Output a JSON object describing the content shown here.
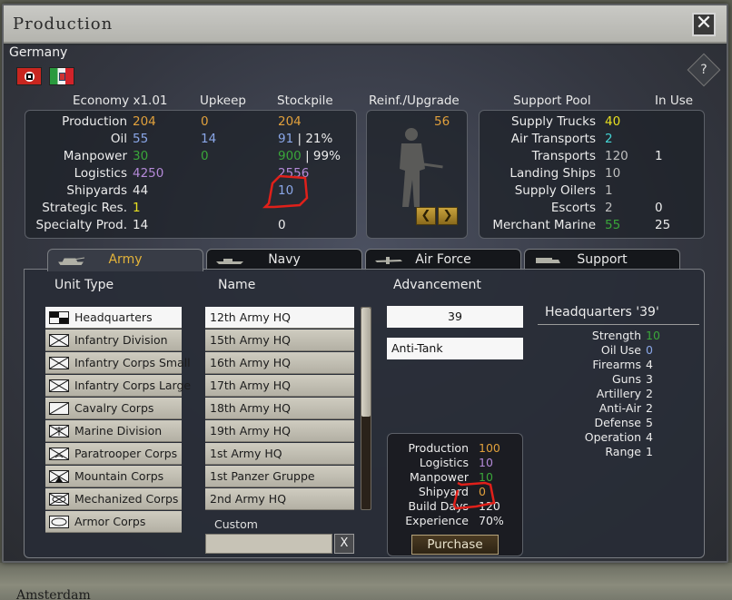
{
  "window": {
    "title": "Production",
    "close_symbol": "✕"
  },
  "map": {
    "city_label": "Amsterdam"
  },
  "country": {
    "name": "Germany",
    "help_symbol": "?"
  },
  "economy": {
    "headers": {
      "economy": "Economy x1.01",
      "upkeep": "Upkeep",
      "stockpile": "Stockpile"
    },
    "rows": [
      {
        "label": "Production",
        "value": "204",
        "value_color": "orange",
        "upkeep": "0",
        "upkeep_color": "orange",
        "stockpile": "204",
        "stockpile_color": "orange"
      },
      {
        "label": "Oil",
        "value": "55",
        "value_color": "blue",
        "upkeep": "14",
        "upkeep_color": "blue",
        "stockpile": "91",
        "stockpile_color": "blue",
        "extra": "| 21%"
      },
      {
        "label": "Manpower",
        "value": "30",
        "value_color": "green",
        "upkeep": "0",
        "upkeep_color": "green",
        "stockpile": "900",
        "stockpile_color": "green",
        "extra": "| 99%"
      },
      {
        "label": "Logistics",
        "value": "4250",
        "value_color": "purple",
        "upkeep": "",
        "stockpile": "2556",
        "stockpile_color": "purple"
      },
      {
        "label": "Shipyards",
        "value": "44",
        "value_color": "white",
        "upkeep": "",
        "stockpile": "10",
        "stockpile_color": "blue"
      },
      {
        "label": "Strategic Res.",
        "value": "1",
        "value_color": "yellow",
        "upkeep": "",
        "stockpile": ""
      },
      {
        "label": "Specialty Prod.",
        "value": "14",
        "value_color": "white",
        "upkeep": "",
        "stockpile": "0",
        "stockpile_color": "white"
      }
    ]
  },
  "reinforce": {
    "header": "Reinf./Upgrade",
    "value": "56",
    "prev_symbol": "❮",
    "next_symbol": "❯"
  },
  "support_pool": {
    "headers": {
      "pool": "Support Pool",
      "in_use": "In Use"
    },
    "rows": [
      {
        "label": "Supply Trucks",
        "value": "40",
        "value_color": "yellow",
        "in_use": ""
      },
      {
        "label": "Air Transports",
        "value": "2",
        "value_color": "cyan",
        "in_use": ""
      },
      {
        "label": "Transports",
        "value": "120",
        "value_color": "gray",
        "in_use": "1"
      },
      {
        "label": "Landing Ships",
        "value": "10",
        "value_color": "gray",
        "in_use": ""
      },
      {
        "label": "Supply Oilers",
        "value": "1",
        "value_color": "gray",
        "in_use": ""
      },
      {
        "label": "Escorts",
        "value": "2",
        "value_color": "gray",
        "in_use": "0"
      },
      {
        "label": "Merchant Marine",
        "value": "55",
        "value_color": "green",
        "in_use": "25"
      }
    ]
  },
  "tabs": [
    {
      "label": "Army",
      "active": true
    },
    {
      "label": "Navy",
      "active": false
    },
    {
      "label": "Air Force",
      "active": false
    },
    {
      "label": "Support",
      "active": false
    }
  ],
  "columns": {
    "unit_type": "Unit Type",
    "name": "Name",
    "advancement": "Advancement"
  },
  "unit_types": [
    {
      "label": "Headquarters",
      "icon": "hq-icon",
      "selected": true
    },
    {
      "label": "Infantry Division",
      "icon": "infantry-icon"
    },
    {
      "label": "Infantry Corps Small",
      "icon": "infantry-icon"
    },
    {
      "label": "Infantry Corps Large",
      "icon": "infantry-icon"
    },
    {
      "label": "Cavalry Corps",
      "icon": "cavalry-icon"
    },
    {
      "label": "Marine Division",
      "icon": "marine-icon"
    },
    {
      "label": "Paratrooper Corps",
      "icon": "paratrooper-icon"
    },
    {
      "label": "Mountain Corps",
      "icon": "mountain-icon"
    },
    {
      "label": "Mechanized Corps",
      "icon": "mechanized-icon"
    },
    {
      "label": "Armor Corps",
      "icon": "armor-icon"
    }
  ],
  "names": [
    {
      "label": "12th Army HQ",
      "selected": true
    },
    {
      "label": "15th Army HQ"
    },
    {
      "label": "16th Army HQ"
    },
    {
      "label": "17th Army HQ"
    },
    {
      "label": "18th Army HQ"
    },
    {
      "label": "19th Army HQ"
    },
    {
      "label": "1st Army HQ"
    },
    {
      "label": "1st Panzer Gruppe"
    },
    {
      "label": "2nd Army HQ"
    }
  ],
  "custom": {
    "label": "Custom",
    "value": "",
    "clear_symbol": "X"
  },
  "advancement": {
    "level": "39",
    "option": "Anti-Tank"
  },
  "cost": {
    "rows": [
      {
        "label": "Production",
        "value": "100",
        "color": "orange"
      },
      {
        "label": "Logistics",
        "value": "10",
        "color": "purple"
      },
      {
        "label": "Manpower",
        "value": "10",
        "color": "green"
      },
      {
        "label": "Shipyard",
        "value": "0",
        "color": "orange"
      },
      {
        "label": "Build Days",
        "value": "120",
        "color": "white"
      },
      {
        "label": "Experience",
        "value": "70%",
        "color": "white"
      }
    ],
    "purchase_label": "Purchase"
  },
  "stats": {
    "title": "Headquarters '39'",
    "rows": [
      {
        "label": "Strength",
        "value": "10",
        "color": "green"
      },
      {
        "label": "Oil Use",
        "value": "0",
        "color": "blue"
      },
      {
        "label": "Firearms",
        "value": "4",
        "color": "white"
      },
      {
        "label": "Guns",
        "value": "3",
        "color": "white"
      },
      {
        "label": "Artillery",
        "value": "2",
        "color": "white"
      },
      {
        "label": "Anti-Air",
        "value": "2",
        "color": "white"
      },
      {
        "label": "Defense",
        "value": "5",
        "color": "white"
      },
      {
        "label": "Operation",
        "value": "4",
        "color": "white"
      },
      {
        "label": "Range",
        "value": "1",
        "color": "white"
      }
    ]
  },
  "colors": {
    "orange": "#e0a03c",
    "blue": "#8aa7e8",
    "green": "#3aa63a",
    "purple": "#b48ad8",
    "yellow": "#e8e020",
    "cyan": "#44d4d4",
    "white": "#ececec",
    "gray": "#bfbfbf",
    "annotation_red": "#e0201a"
  }
}
